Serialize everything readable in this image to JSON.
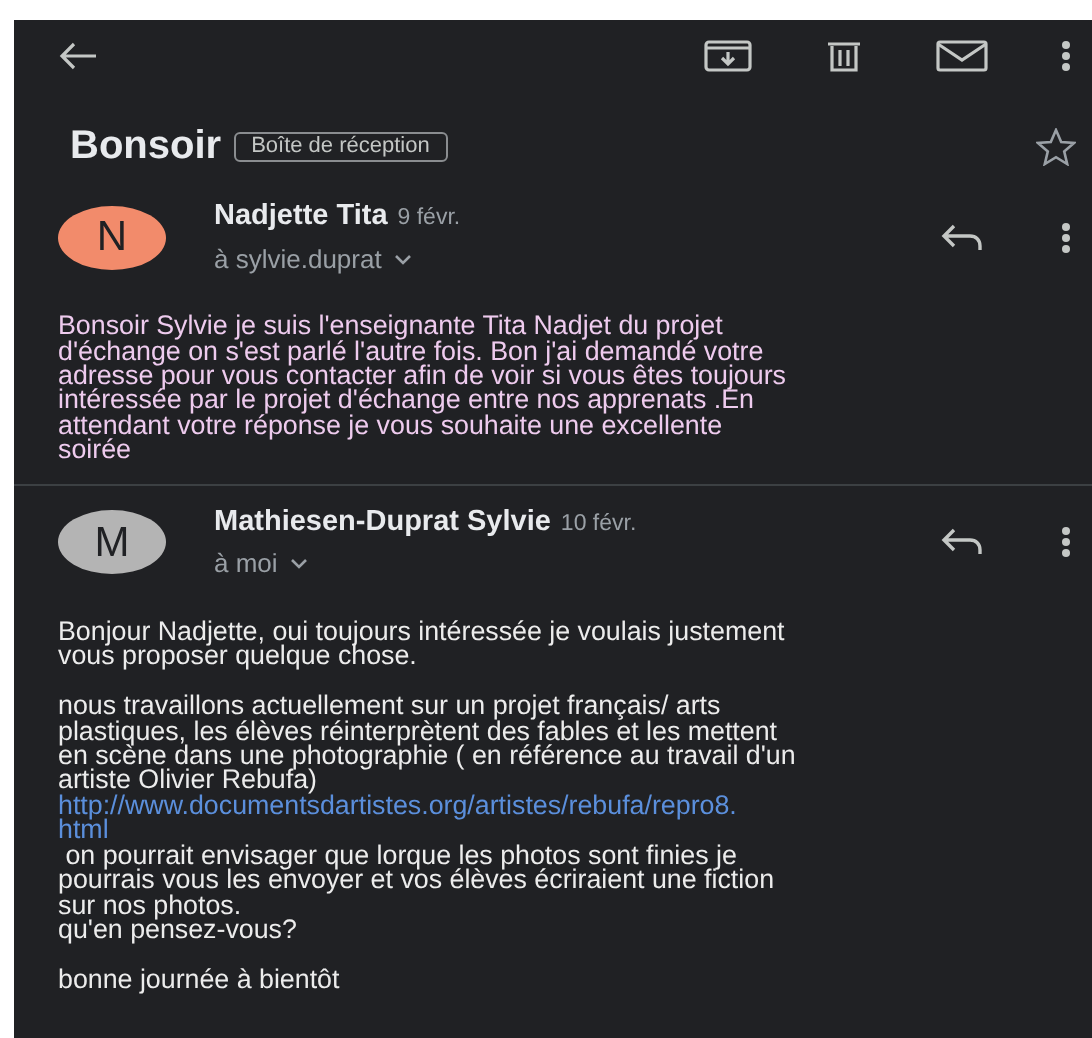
{
  "subject": "Bonsoir",
  "label": "Boîte de réception",
  "starred": false,
  "messages": [
    {
      "avatar_letter": "N",
      "color": "#f28b6b",
      "sender": "Nadjette Tita",
      "date": "9 févr.",
      "recipient": "à sylvie.duprat",
      "kind": "quoted",
      "paragraphs": [
        [
          {
            "kind": "text",
            "text": "Bonsoir Sylvie je suis l'enseignante Tita Nadjet du projet\nd'échange on s'est parlé l'autre fois. Bon j'ai demandé votre\nadresse pour vous contacter afin de voir si vous êtes toujours\nintéressée par le projet d'échange entre nos apprenats .En\nattendant votre réponse je vous souhaite une excellente\nsoirée"
          }
        ]
      ]
    },
    {
      "avatar_letter": "M",
      "color": "#b4b4b4",
      "sender": "Mathiesen-Duprat Sylvie",
      "date": "10 févr.",
      "recipient": "à moi",
      "kind": "plain",
      "paragraphs": [
        [
          {
            "kind": "text",
            "text": "Bonjour Nadjette, oui toujours intéressée je voulais justement\nvous proposer quelque chose."
          }
        ],
        [
          {
            "kind": "text",
            "text": "nous travaillons actuellement sur un projet français/ arts\nplastiques, les élèves réinterprètent des fables et les mettent\nen scène dans une photographie ( en référence au travail d'un\nartiste Olivier Rebufa)"
          },
          {
            "kind": "link",
            "text": "http://www.documentsdartistes.org/artistes/rebufa/repro8.\nhtml"
          },
          {
            "kind": "text",
            "text": " on pourrait envisager que lorque les photos sont finies je\npourrais vous les envoyer et vos élèves écriraient une fiction\nsur nos photos.\nqu'en pensez-vous?"
          }
        ],
        [
          {
            "kind": "text",
            "text": "bonne journée à bientôt"
          }
        ]
      ]
    }
  ]
}
